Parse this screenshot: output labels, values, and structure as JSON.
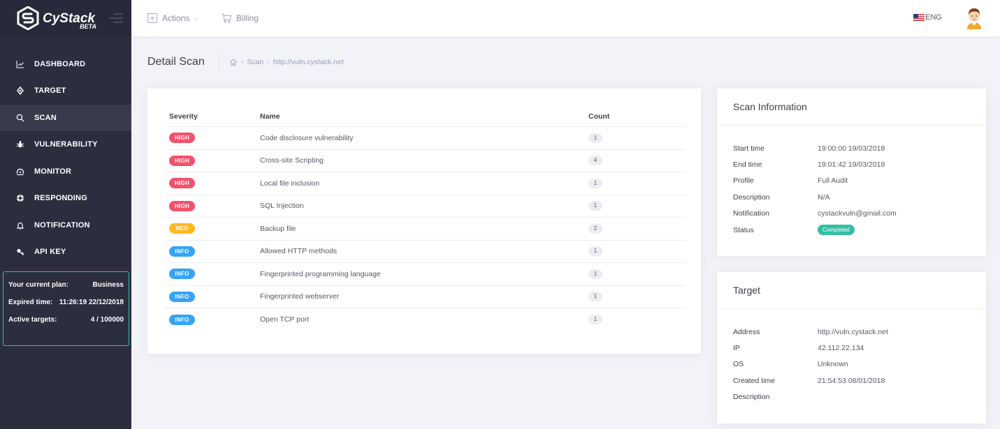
{
  "brand": {
    "name": "CyStack",
    "tag": "BETA"
  },
  "sidebar": {
    "items": [
      {
        "label": "DASHBOARD",
        "icon": "chart-line-icon",
        "active": false
      },
      {
        "label": "TARGET",
        "icon": "crosshair-icon",
        "active": false
      },
      {
        "label": "SCAN",
        "icon": "search-icon",
        "active": true
      },
      {
        "label": "VULNERABILITY",
        "icon": "bug-icon",
        "active": false
      },
      {
        "label": "MONITOR",
        "icon": "monitor-icon",
        "active": false
      },
      {
        "label": "RESPONDING",
        "icon": "lifebuoy-icon",
        "active": false
      },
      {
        "label": "NOTIFICATION",
        "icon": "bell-icon",
        "active": false
      },
      {
        "label": "API KEY",
        "icon": "key-icon",
        "active": false
      }
    ],
    "plan": {
      "plan_label": "Your current plan:",
      "plan_value": "Business",
      "expired_label": "Expired time:",
      "expired_value": "11:26:19 22/12/2018",
      "targets_label": "Active targets:",
      "targets_value": "4 / 100000"
    }
  },
  "topbar": {
    "actions_label": "Actions",
    "billing_label": "Billing",
    "language": "ENG"
  },
  "page": {
    "title": "Detail Scan",
    "breadcrumb": [
      "Scan",
      "http://vuln.cystack.net"
    ]
  },
  "scan_table": {
    "headers": {
      "severity": "Severity",
      "name": "Name",
      "count": "Count"
    },
    "rows": [
      {
        "severity": "HIGH",
        "name": "Code disclosure vulnerability",
        "count": "1"
      },
      {
        "severity": "HIGH",
        "name": "Cross-site Scripting",
        "count": "4"
      },
      {
        "severity": "HIGH",
        "name": "Local file inclusion",
        "count": "1"
      },
      {
        "severity": "HIGH",
        "name": "SQL Injection",
        "count": "1"
      },
      {
        "severity": "MED",
        "name": "Backup file",
        "count": "2"
      },
      {
        "severity": "INFO",
        "name": "Allowed HTTP methods",
        "count": "1"
      },
      {
        "severity": "INFO",
        "name": "Fingerprinted programming language",
        "count": "1"
      },
      {
        "severity": "INFO",
        "name": "Fingerprinted webserver",
        "count": "1"
      },
      {
        "severity": "INFO",
        "name": "Open TCP port",
        "count": "1"
      }
    ]
  },
  "severity_colors": {
    "HIGH": "#f4516c",
    "MED": "#ffb822",
    "INFO": "#36a3f7"
  },
  "scan_info": {
    "title": "Scan Information",
    "fields": [
      {
        "key": "Start time",
        "value": "19:00:00 19/03/2018"
      },
      {
        "key": "End time",
        "value": "19:01:42 19/03/2018"
      },
      {
        "key": "Profile",
        "value": "Full Audit"
      },
      {
        "key": "Description",
        "value": "N/A"
      },
      {
        "key": "Notification",
        "value": "cystackvuln@gmail.com"
      }
    ],
    "status_label": "Status",
    "status_value": "Completed",
    "status_color": "#34bfa3"
  },
  "target_info": {
    "title": "Target",
    "fields": [
      {
        "key": "Address",
        "value": "http://vuln.cystack.net"
      },
      {
        "key": "IP",
        "value": "42.112.22.134"
      },
      {
        "key": "OS",
        "value": "Unknown"
      },
      {
        "key": "Created time",
        "value": "21:54:53 08/01/2018"
      },
      {
        "key": "Description",
        "value": ""
      }
    ]
  }
}
